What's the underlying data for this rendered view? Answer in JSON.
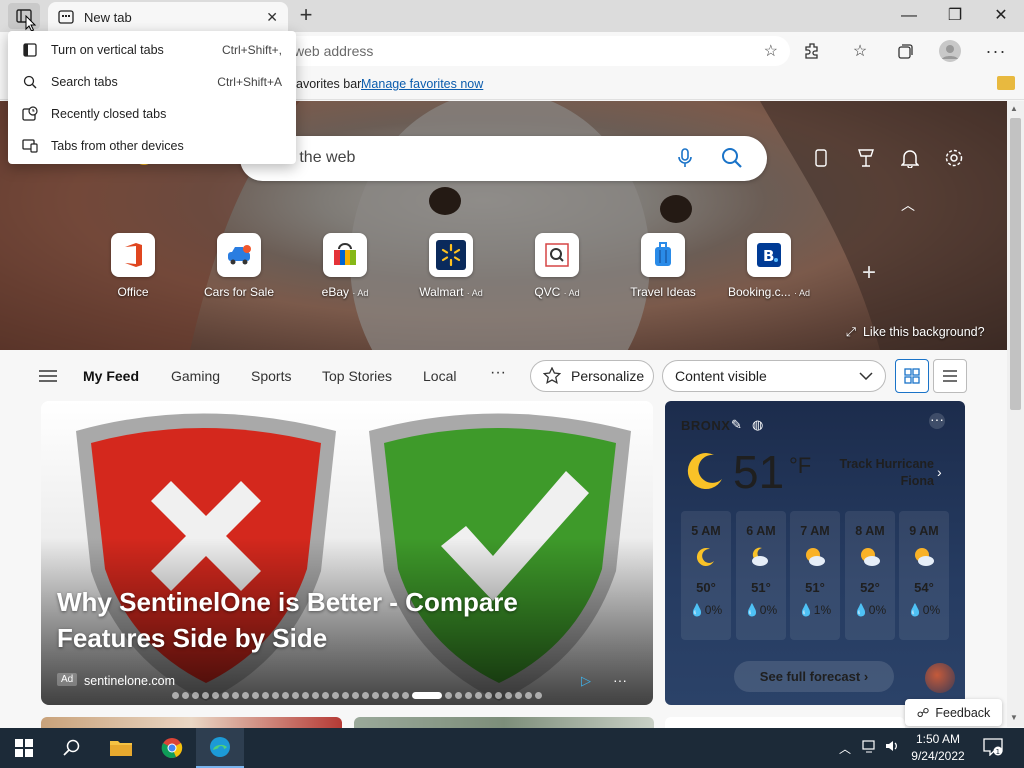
{
  "browser": {
    "tab_title": "New tab",
    "address_placeholder": "Search or enter web address",
    "address_visible": "web address",
    "favbar_text": "avorites bar.",
    "favbar_link": "Manage favorites now"
  },
  "tab_menu": {
    "items": [
      {
        "label": "Turn on vertical tabs",
        "shortcut": "Ctrl+Shift+,",
        "icon": "vertical-tabs-icon"
      },
      {
        "label": "Search tabs",
        "shortcut": "Ctrl+Shift+A",
        "icon": "search-icon"
      },
      {
        "label": "Recently closed tabs",
        "shortcut": "",
        "icon": "recently-closed-icon"
      },
      {
        "label": "Tabs from other devices",
        "shortcut": "",
        "icon": "devices-icon"
      }
    ]
  },
  "hero": {
    "search_placeholder": "n the web",
    "like_background": "Like this background?"
  },
  "quick_links": [
    {
      "label": "Office",
      "ad": ""
    },
    {
      "label": "Cars for Sale",
      "ad": ""
    },
    {
      "label": "eBay",
      "ad": "· Ad"
    },
    {
      "label": "Walmart",
      "ad": "· Ad"
    },
    {
      "label": "QVC",
      "ad": "· Ad"
    },
    {
      "label": "Travel Ideas",
      "ad": ""
    },
    {
      "label": "Booking.c...",
      "ad": "· Ad"
    }
  ],
  "feed_nav": {
    "items": [
      "My Feed",
      "Gaming",
      "Sports",
      "Top Stories",
      "Local"
    ],
    "more": "···",
    "personalize": "Personalize",
    "content_visible": "Content visible"
  },
  "main_card": {
    "title": "Why SentinelOne is Better - Compare Features Side by Side",
    "badge": "Ad",
    "source": "sentinelone.com",
    "dot_count": 35,
    "active_dot": 24
  },
  "weather": {
    "location": "BRONX",
    "temp": "51",
    "unit": "°F",
    "alert": "Track Hurricane Fiona",
    "hours": [
      {
        "time": "5 AM",
        "temp": "50°",
        "precip": "0%",
        "icon": "moon-icon"
      },
      {
        "time": "6 AM",
        "temp": "51°",
        "precip": "0%",
        "icon": "cloudy-moon-icon"
      },
      {
        "time": "7 AM",
        "temp": "51°",
        "precip": "1%",
        "icon": "partly-sunny-icon"
      },
      {
        "time": "8 AM",
        "temp": "52°",
        "precip": "0%",
        "icon": "partly-sunny-icon"
      },
      {
        "time": "9 AM",
        "temp": "54°",
        "precip": "0%",
        "icon": "partly-sunny-icon"
      }
    ],
    "forecast_button": "See full forecast"
  },
  "feedback": "Feedback",
  "taskbar": {
    "time": "1:50 AM",
    "date": "9/24/2022"
  },
  "colors": {
    "accent": "#0b5cad",
    "taskbar": "#1c2a38",
    "weather_bg": "#1c2c4c"
  }
}
